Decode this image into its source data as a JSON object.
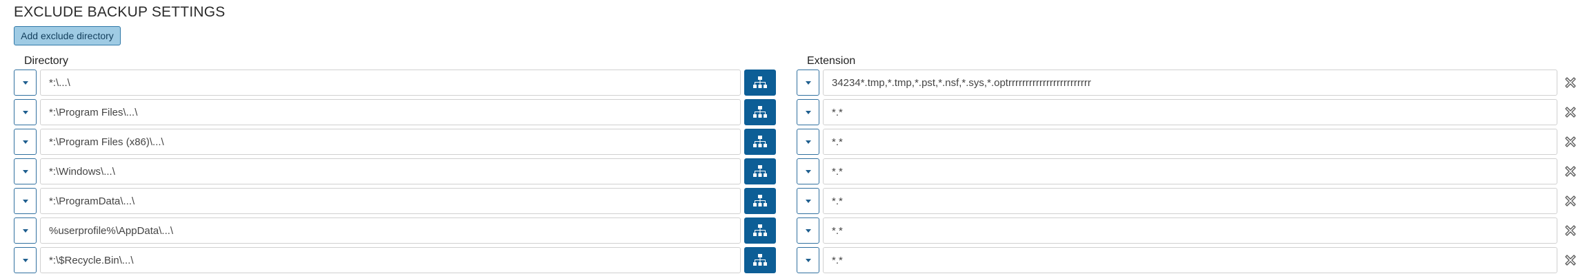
{
  "header": {
    "title": "EXCLUDE BACKUP SETTINGS",
    "add_button_label": "Add exclude directory"
  },
  "columns": {
    "directory": "Directory",
    "extension": "Extension"
  },
  "icons": {
    "dropdown": "chevron-down-icon",
    "browse": "sitemap-icon",
    "remove": "remove-x-icon"
  },
  "colors": {
    "accent": "#0d5e96",
    "add_button_bg": "#9fcbe4",
    "border": "#2f6f9f"
  },
  "rows": [
    {
      "directory": "*:\\...\\",
      "extension": "34234*.tmp,*.tmp,*.pst,*.nsf,*.sys,*.optrrrrrrrrrrrrrrrrrrrrrrrr"
    },
    {
      "directory": "*:\\Program Files\\...\\",
      "extension": "*.*"
    },
    {
      "directory": "*:\\Program Files (x86)\\...\\",
      "extension": "*.*"
    },
    {
      "directory": "*:\\Windows\\...\\",
      "extension": "*.*"
    },
    {
      "directory": "*:\\ProgramData\\...\\",
      "extension": "*.*"
    },
    {
      "directory": "%userprofile%\\AppData\\...\\",
      "extension": "*.*"
    },
    {
      "directory": "*:\\$Recycle.Bin\\...\\",
      "extension": "*.*"
    }
  ]
}
